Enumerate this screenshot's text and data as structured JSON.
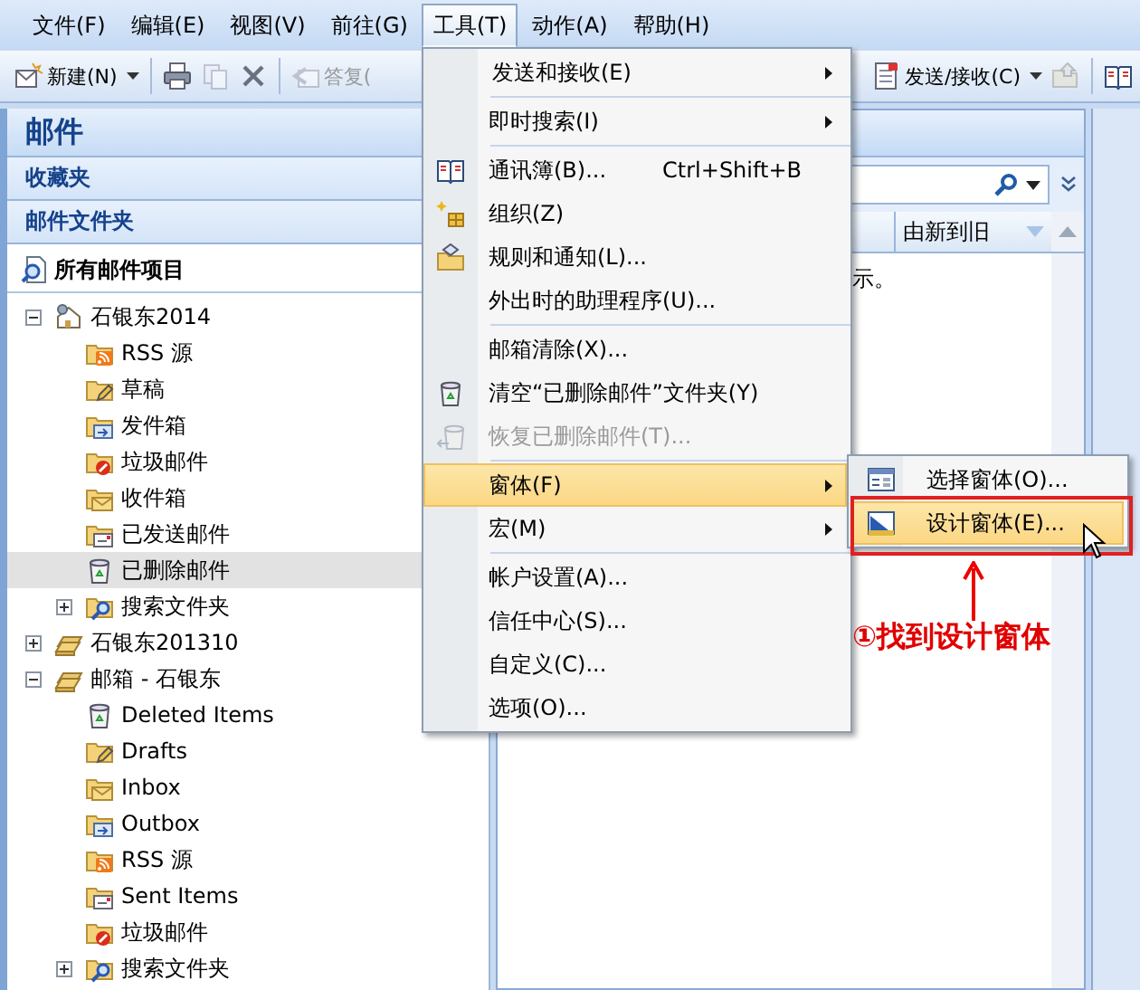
{
  "menubar": [
    {
      "label": "文件(F)",
      "selected": false
    },
    {
      "label": "编辑(E)",
      "selected": false
    },
    {
      "label": "视图(V)",
      "selected": false
    },
    {
      "label": "前往(G)",
      "selected": false
    },
    {
      "label": "工具(T)",
      "selected": true
    },
    {
      "label": "动作(A)",
      "selected": false
    },
    {
      "label": "帮助(H)",
      "selected": false
    }
  ],
  "toolbar": {
    "left": [
      {
        "kind": "new",
        "label": "新建(N)",
        "dropdown": true,
        "disabled": false,
        "separator_after": true
      },
      {
        "kind": "print",
        "disabled": false
      },
      {
        "kind": "move",
        "disabled": true
      },
      {
        "kind": "delete",
        "disabled": false,
        "separator_after": true
      },
      {
        "kind": "reply",
        "label": "答复(",
        "disabled": true
      }
    ],
    "right": [
      {
        "kind": "sendrecv",
        "label": "发送/接收(C)",
        "dropdown": true,
        "disabled": false
      },
      {
        "kind": "folder",
        "disabled": true,
        "separator_after": true
      },
      {
        "kind": "book",
        "disabled": false
      }
    ]
  },
  "navigation": {
    "title": "邮件",
    "sections": [
      "收藏夹",
      "邮件文件夹"
    ],
    "all_items": "所有邮件项目",
    "tree": [
      {
        "label": "石银东2014",
        "kind": "house",
        "selected": false,
        "expanded": true,
        "children": [
          {
            "label": "RSS 源",
            "kind": "rss",
            "selected": false
          },
          {
            "label": "草稿",
            "kind": "drafts",
            "selected": false
          },
          {
            "label": "发件箱",
            "kind": "outbox",
            "selected": false
          },
          {
            "label": "垃圾邮件",
            "kind": "junk",
            "selected": false
          },
          {
            "label": "收件箱",
            "kind": "inbox",
            "selected": false
          },
          {
            "label": "已发送邮件",
            "kind": "sent",
            "selected": false
          },
          {
            "label": "已删除邮件",
            "kind": "trash",
            "selected": true
          },
          {
            "label": "搜索文件夹",
            "kind": "search",
            "selected": false,
            "expanded": false
          }
        ]
      },
      {
        "label": "石银东201310",
        "kind": "store",
        "selected": false,
        "expanded": false
      },
      {
        "label": "邮箱 - 石银东",
        "kind": "store",
        "selected": false,
        "expanded": true,
        "children": [
          {
            "label": "Deleted Items",
            "kind": "trash",
            "selected": false
          },
          {
            "label": "Drafts",
            "kind": "drafts",
            "selected": false
          },
          {
            "label": "Inbox",
            "kind": "inbox",
            "selected": false
          },
          {
            "label": "Outbox",
            "kind": "outbox",
            "selected": false
          },
          {
            "label": "RSS 源",
            "kind": "rss",
            "selected": false
          },
          {
            "label": "Sent Items",
            "kind": "sent",
            "selected": false
          },
          {
            "label": "垃圾邮件",
            "kind": "junk",
            "selected": false
          },
          {
            "label": "搜索文件夹",
            "kind": "search",
            "selected": false,
            "expanded": false
          }
        ]
      }
    ]
  },
  "message_list": {
    "sort_label": "由新到旧",
    "message": "示。"
  },
  "tools_menu": {
    "groups": [
      [
        {
          "label": "发送和接收(E)",
          "submenu": true,
          "disabled": false,
          "selected": false
        }
      ],
      [
        {
          "label": "即时搜索(I)",
          "submenu": true,
          "disabled": false,
          "selected": false
        }
      ],
      [
        {
          "label": "通讯簿(B)...",
          "shortcut": "Ctrl+Shift+B",
          "kind": "book",
          "submenu": false,
          "disabled": false,
          "selected": false
        },
        {
          "label": "组织(Z)",
          "kind": "organize",
          "submenu": false,
          "disabled": false,
          "selected": false
        },
        {
          "label": "规则和通知(L)...",
          "kind": "rules",
          "submenu": false,
          "disabled": false,
          "selected": false
        },
        {
          "label": "外出时的助理程序(U)...",
          "submenu": false,
          "disabled": false,
          "selected": false
        }
      ],
      [
        {
          "label": "邮箱清除(X)...",
          "submenu": false,
          "disabled": false,
          "selected": false
        },
        {
          "label": "清空“已删除邮件”文件夹(Y)",
          "kind": "trash",
          "submenu": false,
          "disabled": false,
          "selected": false
        },
        {
          "label": "恢复已删除邮件(T)...",
          "kind": "restore",
          "submenu": false,
          "disabled": true,
          "selected": false
        }
      ],
      [
        {
          "label": "窗体(F)",
          "submenu": true,
          "disabled": false,
          "selected": true
        },
        {
          "label": "宏(M)",
          "submenu": true,
          "disabled": false,
          "selected": false
        }
      ],
      [
        {
          "label": "帐户设置(A)...",
          "submenu": false,
          "disabled": false,
          "selected": false
        },
        {
          "label": "信任中心(S)...",
          "submenu": false,
          "disabled": false,
          "selected": false
        },
        {
          "label": "自定义(C)...",
          "submenu": false,
          "disabled": false,
          "selected": false
        },
        {
          "label": "选项(O)...",
          "submenu": false,
          "disabled": false,
          "selected": false
        }
      ]
    ]
  },
  "forms_submenu": [
    {
      "label": "选择窗体(O)...",
      "kind": "form",
      "selected": false
    },
    {
      "label": "设计窗体(E)...",
      "kind": "design",
      "selected": true
    }
  ],
  "annotation": {
    "text": "①找到设计窗体"
  }
}
